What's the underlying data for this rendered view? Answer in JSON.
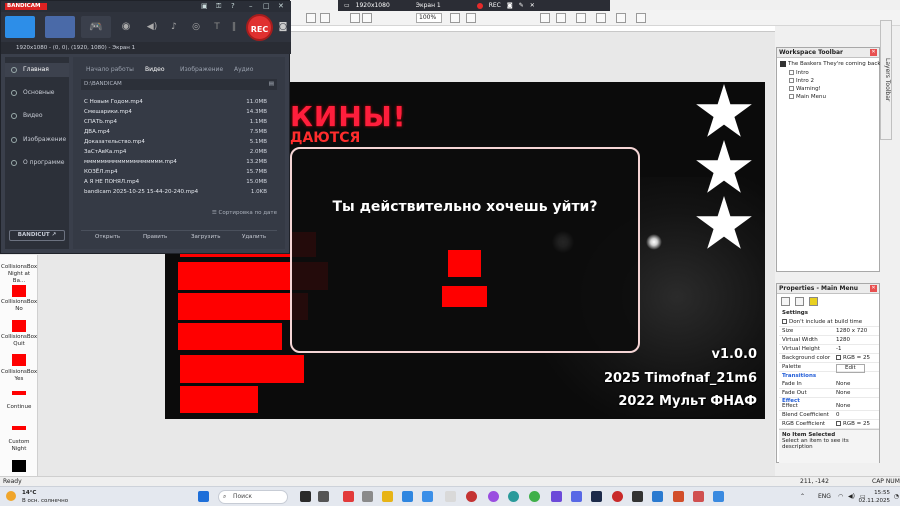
{
  "capture_bar": {
    "resolution": "1920x1080",
    "screen": "Экран 1",
    "rec_label": "REC"
  },
  "editor": {
    "zoom": "100%"
  },
  "game": {
    "title_top": "КИНЫ!",
    "title_sub": "ДАЮТСЯ",
    "dialog_question": "Ты действительно хочешь уйти?",
    "version": "v1.0.0",
    "credit_line1": "2025 Timofnaf_21m6",
    "credit_line2": "2022 Мульт ФНАФ"
  },
  "object_list": [
    {
      "label": "CollisionsBox Night at Ba...",
      "color": "#ff0000"
    },
    {
      "label": "CollisionsBox No",
      "color": "#ff0000"
    },
    {
      "label": "CollisionsBox Quit",
      "color": "#ff0000"
    },
    {
      "label": "CollisionsBox Yes",
      "color": "#ff0000"
    },
    {
      "label": "Continue",
      "color": "#cc3333"
    },
    {
      "label": "Custom Night",
      "color": "#cc3333"
    }
  ],
  "bandicam": {
    "logo": "BANDICAM",
    "source": "1920x1080 - (0, 0), (1920, 1080) - Экран 1",
    "rec_label": "REC",
    "sidebar": [
      "Главная",
      "Основные",
      "Видео",
      "Изображение",
      "О программе"
    ],
    "bandicut": "BANDICUT ↗",
    "tabs": [
      "Начало работы",
      "Видео",
      "Изображение",
      "Аудио"
    ],
    "path": "D:\\BANDICAM",
    "files": [
      {
        "name": "С Новым Годом.mp4",
        "size": "11.0MB"
      },
      {
        "name": "Смешарики.mp4",
        "size": "14.3MB"
      },
      {
        "name": "СПАТЬ.mp4",
        "size": "1.1MB"
      },
      {
        "name": "ДВА.mp4",
        "size": "7.5MB"
      },
      {
        "name": "Доказательство.mp4",
        "size": "5.1MB"
      },
      {
        "name": "ЗаСтАвКа.mp4",
        "size": "2.0MB"
      },
      {
        "name": "ммммммммммммммммммм.mp4",
        "size": "13.2MB"
      },
      {
        "name": "КОЗЁЛ.mp4",
        "size": "15.7MB"
      },
      {
        "name": "А Я НЕ ПОНЯЛ.mp4",
        "size": "15.0MB"
      },
      {
        "name": "bandicam 2025-10-25 15-44-20-240.mp4",
        "size": "1.0KB"
      }
    ],
    "sort_label": "Сортировка по дате",
    "actions": [
      "Открыть",
      "Править",
      "Загрузить",
      "Удалить"
    ]
  },
  "workspace": {
    "title": "Workspace Toolbar",
    "root": "The Baskers They're coming back",
    "items": [
      "Intro",
      "Intro 2",
      "Warning!",
      "Main Menu"
    ],
    "layers_tab": "Layers Toolbar"
  },
  "properties": {
    "title": "Properties - Main Menu",
    "settings_label": "Settings",
    "dont_include": "Don't include at build time",
    "rows": [
      {
        "key": "Size",
        "value": "1280 x 720"
      },
      {
        "key": "Virtual Width",
        "value": "1280"
      },
      {
        "key": "Virtual Height",
        "value": "-1"
      },
      {
        "key": "Background color",
        "value": "RGB = 25"
      },
      {
        "key": "Palette",
        "value": "Edit"
      }
    ],
    "transitions_label": "Transitions",
    "transition_rows": [
      {
        "key": "Fade In",
        "value": "None"
      },
      {
        "key": "Fade Out",
        "value": "None"
      }
    ],
    "effect_label": "Effect",
    "effect_rows": [
      {
        "key": "Effect",
        "value": "None"
      },
      {
        "key": "Blend Coefficient",
        "value": "0"
      },
      {
        "key": "RGB Coefficient",
        "value": "RGB = 25"
      }
    ],
    "help_title": "No Item Selected",
    "help_text": "Select an item to see its description"
  },
  "statusbar": {
    "left": "Ready",
    "coords": "211, -142",
    "caps": "CAP NUM"
  },
  "taskbar": {
    "weather_temp": "14°C",
    "weather_desc": "В осн. солнечно",
    "search": "Поиск",
    "lang": "ENG",
    "time": "15:55",
    "date": "02.11.2025"
  }
}
